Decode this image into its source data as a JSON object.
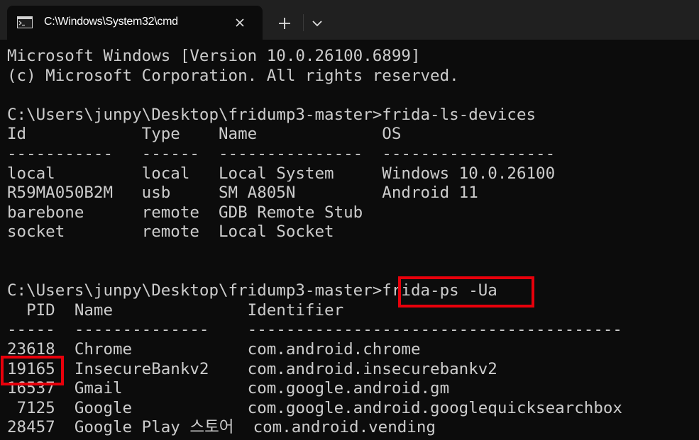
{
  "window": {
    "tab_title": "C:\\Windows\\System32\\cmd",
    "tab_icon": "terminal-icon",
    "close_icon": "close-icon",
    "new_tab_icon": "plus-icon",
    "dropdown_icon": "chevron-down-icon"
  },
  "terminal": {
    "lines": [
      "Microsoft Windows [Version 10.0.26100.6899]",
      "(c) Microsoft Corporation. All rights reserved.",
      "",
      "C:\\Users\\junpy\\Desktop\\fridump3-master>frida-ls-devices",
      "Id            Type    Name             OS",
      "-----------   ------  ---------------  ------------------",
      "local         local   Local System     Windows 10.0.26100",
      "R59MA050B2M   usb     SM A805N         Android 11",
      "barebone      remote  GDB Remote Stub",
      "socket        remote  Local Socket",
      "",
      "",
      "C:\\Users\\junpy\\Desktop\\fridump3-master>frida-ps -Ua",
      "  PID  Name              Identifier",
      "-----  --------------    ---------------------------------------",
      "23618  Chrome            com.android.chrome",
      "19165  InsecureBankv2    com.android.insecurebankv2",
      "16537  Gmail             com.google.android.gm",
      " 7125  Google            com.google.android.googlequicksearchbox",
      "28457  Google Play 스토어  com.android.vending"
    ]
  },
  "highlights": {
    "color": "#e8000b",
    "command": "frida-ps -Ua",
    "pid": "19165"
  },
  "colors": {
    "background": "#0c0c0c",
    "tabbar": "#202020",
    "text": "#cccccc"
  }
}
